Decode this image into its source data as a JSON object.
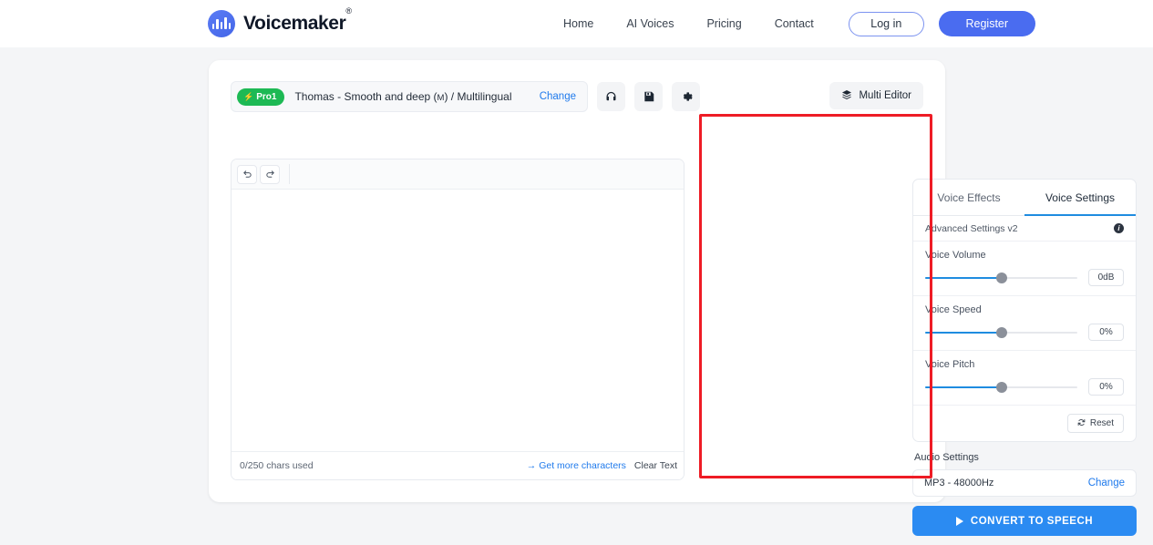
{
  "header": {
    "brand": {
      "name": "Voicemaker",
      "trademark": "®",
      "logo_icon": "soundwave-logo-icon"
    },
    "nav": [
      {
        "label": "Home"
      },
      {
        "label": "AI Voices"
      },
      {
        "label": "Pricing"
      },
      {
        "label": "Contact"
      }
    ],
    "login_label": "Log in",
    "register_label": "Register",
    "register_color": "#4a6cf0"
  },
  "voice_bar": {
    "badge": "Pro1",
    "badge_color": "#1db954",
    "voice_name": "Thomas - Smooth and deep (",
    "voice_gender": "M",
    "voice_suffix": ") / Multilingual",
    "change_label": "Change",
    "icons": [
      {
        "name": "headphones-icon"
      },
      {
        "name": "save-icon"
      },
      {
        "name": "gear-icon"
      }
    ],
    "multi_editor_label": "Multi Editor"
  },
  "editor": {
    "undo_icon": "undo-icon",
    "redo_icon": "redo-icon",
    "content": "",
    "chars_used": "0/250 chars used",
    "get_more_label": "Get more characters",
    "clear_text_label": "Clear Text"
  },
  "settings": {
    "tabs": [
      {
        "label": "Voice Effects",
        "active": false
      },
      {
        "label": "Voice Settings",
        "active": true
      }
    ],
    "advanced_label": "Advanced Settings v2",
    "info_icon": "info-icon",
    "sliders": [
      {
        "label": "Voice Volume",
        "value": "0dB",
        "percent": 50
      },
      {
        "label": "Voice Speed",
        "value": "0%",
        "percent": 50
      },
      {
        "label": "Voice Pitch",
        "value": "0%",
        "percent": 50
      }
    ],
    "reset_label": "Reset",
    "reset_icon": "refresh-icon",
    "audio_title": "Audio Settings",
    "audio_format": "MP3 - 48000Hz",
    "audio_change_label": "Change",
    "convert_label": "CONVERT TO SPEECH",
    "convert_icon": "play-icon",
    "convert_color": "#2b8bf2",
    "accent_color": "#1f8ce0"
  },
  "annotation": {
    "color": "#ee1c25"
  }
}
